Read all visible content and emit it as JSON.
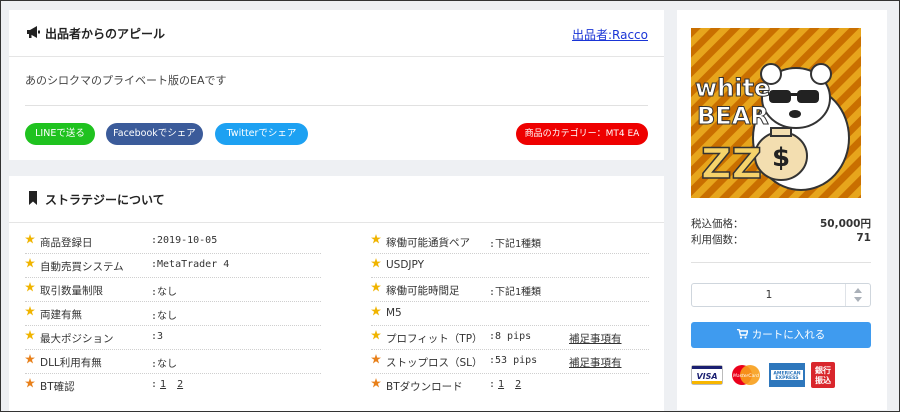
{
  "appeal": {
    "title": "出品者からのアピール",
    "seller_link": "出品者:Racco",
    "description": "あのシロクマのプライベート版のEAです",
    "share": {
      "line": "LINEで送る",
      "facebook": "Facebookでシェア",
      "twitter": "Twitterでシェア"
    },
    "category": "商品のカテゴリー：MT4 EA"
  },
  "strategy": {
    "title": "ストラテジーについて",
    "left": [
      {
        "label": "商品登録日",
        "value": ":2019-10-05"
      },
      {
        "label": "自動売買システム",
        "value": ":MetaTrader 4"
      },
      {
        "label": "取引数量制限",
        "value": ":なし"
      },
      {
        "label": "両建有無",
        "value": ":なし"
      },
      {
        "label": "最大ポジション",
        "value": ":3"
      },
      {
        "label": "DLL利用有無",
        "value": ":なし"
      }
    ],
    "bt_confirm": {
      "label": "BT確認",
      "prefix": ":",
      "links": [
        "1",
        "2"
      ]
    },
    "right": [
      {
        "label": "稼働可能通貨ペア",
        "value": ":下記1種類"
      },
      {
        "label": "USDJPY",
        "value": ""
      },
      {
        "label": "稼働可能時間足",
        "value": ":下記1種類"
      },
      {
        "label": "M5",
        "value": ""
      },
      {
        "label": "プロフィット（TP）",
        "value": ":8 pips",
        "note": "補足事項有"
      },
      {
        "label": "ストップロス（SL）",
        "value": ":53 pips",
        "note": "補足事項有"
      }
    ],
    "bt_download": {
      "label": "BTダウンロード",
      "prefix": ":",
      "links": [
        "1",
        "2"
      ]
    }
  },
  "product": {
    "image_text": {
      "line1": "white",
      "line2": "BEAR",
      "line3": "ZZ",
      "bag": "$"
    },
    "price_label": "税込価格：",
    "price_value": "50,000円",
    "users_label": "利用個数：",
    "users_value": "71",
    "quantity": "1",
    "cart_button": "カートに入れる",
    "payment": {
      "visa": "VISA",
      "mastercard": "MasterCard",
      "amex1": "AMERICAN",
      "amex2": "EXPRESS",
      "bank1": "銀行",
      "bank2": "振込"
    }
  },
  "colors": {
    "line": "#1fc21f",
    "facebook": "#3b5b9a",
    "twitter": "#1da1f2",
    "category": "#ee0000",
    "cart": "#3f9bef",
    "star_gold": "#f0b400",
    "star_orange": "#e8801a"
  }
}
